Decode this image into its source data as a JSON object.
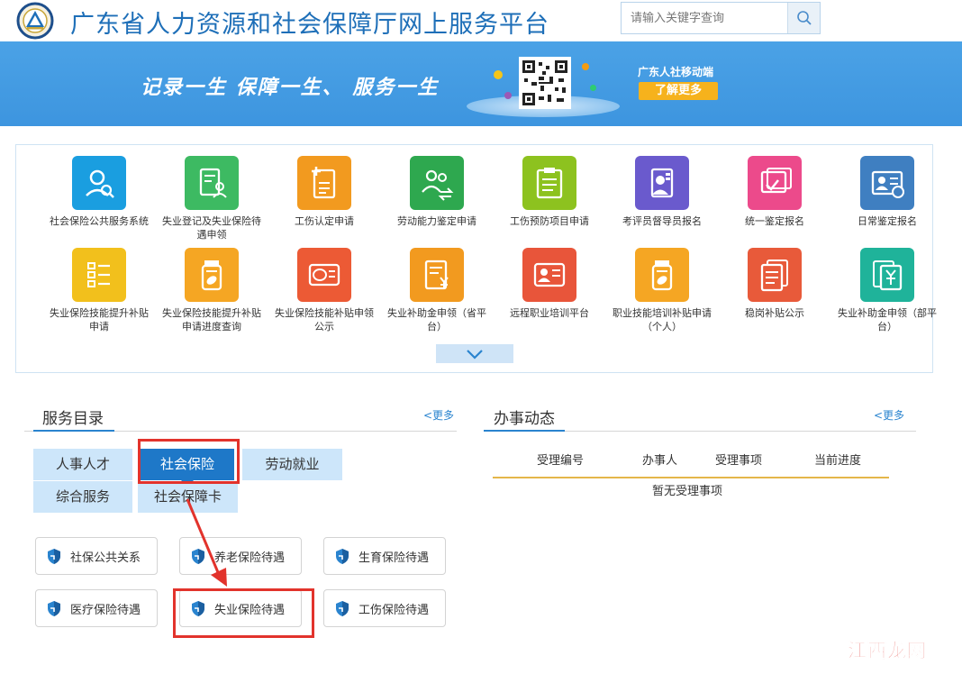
{
  "header": {
    "site_title": "广东省人力资源和社会保障厅网上服务平台",
    "search_placeholder": "请输入关键字查询"
  },
  "banner": {
    "slogan": "记录一生   保障一生、  服务一生",
    "mobile_title": "广东人社移动端",
    "learn_more": "了解更多"
  },
  "services": [
    {
      "label": "社会保险公共服务系统",
      "color": "#1a9ee0",
      "icon": "person-search-icon"
    },
    {
      "label": "失业登记及失业保险待遇申领",
      "color": "#3dba62",
      "icon": "form-person-icon"
    },
    {
      "label": "工伤认定申请",
      "color": "#f29a1f",
      "icon": "document-add-icon"
    },
    {
      "label": "劳动能力鉴定申请",
      "color": "#2ea84f",
      "icon": "people-exchange-icon"
    },
    {
      "label": "工伤预防项目申请",
      "color": "#8dc21f",
      "icon": "clipboard-icon"
    },
    {
      "label": "考评员督导员报名",
      "color": "#6a5acd",
      "icon": "id-badge-icon"
    },
    {
      "label": "统一鉴定报名",
      "color": "#ec4a8b",
      "icon": "certificate-icon"
    },
    {
      "label": "日常鉴定报名",
      "color": "#3f7fc1",
      "icon": "id-card-icon"
    },
    {
      "label": "失业保险技能提升补贴申请",
      "color": "#f2c01c",
      "icon": "checklist-icon"
    },
    {
      "label": "失业保险技能提升补贴申请进度查询",
      "color": "#f5a623",
      "icon": "medicine-bottle-icon"
    },
    {
      "label": "失业保险技能补贴申领公示",
      "color": "#ec5a35",
      "icon": "si-card-icon"
    },
    {
      "label": "失业补助金申领（省平台）",
      "color": "#f29a1f",
      "icon": "yuan-doc-icon"
    },
    {
      "label": "远程职业培训平台",
      "color": "#e8553a",
      "icon": "person-card-icon"
    },
    {
      "label": "职业技能培训补贴申请（个人）",
      "color": "#f5a623",
      "icon": "medicine-bottle-icon"
    },
    {
      "label": "稳岗补贴公示",
      "color": "#e85a3a",
      "icon": "stacked-docs-icon"
    },
    {
      "label": "失业补助金申领（部平台）",
      "color": "#1fb39a",
      "icon": "yuan-stack-icon"
    }
  ],
  "catalog": {
    "title": "服务目录",
    "more": "<更多",
    "tabs": [
      "人事人才",
      "社会保险",
      "劳动就业",
      "综合服务",
      "社会保障卡"
    ],
    "active_tab": "社会保险",
    "items": [
      "社保公共关系",
      "养老保险待遇",
      "生育保险待遇",
      "医疗保险待遇",
      "失业保险待遇",
      "工伤保险待遇"
    ]
  },
  "affairs": {
    "title": "办事动态",
    "more": "<更多",
    "columns": [
      "受理编号",
      "办事人",
      "受理事项",
      "当前进度"
    ],
    "empty": "暂无受理事项"
  },
  "watermark": {
    "text": "江西龙网"
  },
  "colors": {
    "brand_blue": "#1e6fb8",
    "banner_blue": "#3d95df",
    "active_tab": "#1e78c8",
    "tab_bg": "#cde6fa",
    "annotation_red": "#e2332c",
    "button_orange": "#f6b21c",
    "table_rule": "#e4b64a"
  }
}
